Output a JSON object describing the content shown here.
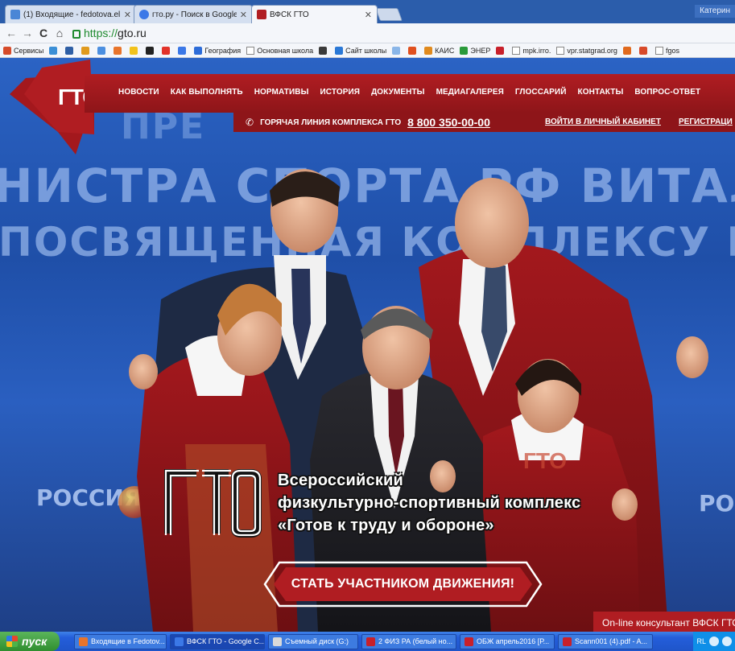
{
  "browser": {
    "tabs": [
      {
        "title": "(1) Входящие - fedotova.el",
        "favicon_color": "#4a86d6",
        "active": false
      },
      {
        "title": "гто.ру - Поиск в Google",
        "favicon_color": "#3b78e7",
        "active": false
      },
      {
        "title": "ВФСК ГТО",
        "favicon_color": "#b01d22",
        "active": true
      }
    ],
    "user_label": "Катерин",
    "url_protocol": "https://",
    "url_host": "gto.ru",
    "bookmarks": [
      {
        "label": "Сервисы",
        "icon": "apps-grid-icon",
        "color": "#d64b2a"
      },
      {
        "label": "",
        "icon": "mail-icon",
        "color": "#3b8fd6"
      },
      {
        "label": "",
        "icon": "vk-icon",
        "color": "#2f5fa5"
      },
      {
        "label": "",
        "icon": "flower-icon",
        "color": "#e09a1e"
      },
      {
        "label": "",
        "icon": "calendar-icon",
        "color": "#4c8fe0"
      },
      {
        "label": "",
        "icon": "play-icon",
        "color": "#e8742b"
      },
      {
        "label": "",
        "icon": "bar-icon",
        "color": "#f2c21b"
      },
      {
        "label": "",
        "icon": "home-icon",
        "color": "#222222"
      },
      {
        "label": "",
        "icon": "yandex-icon",
        "color": "#e2322a"
      },
      {
        "label": "",
        "icon": "google-icon",
        "color": "#3b78e7"
      },
      {
        "label": "География",
        "icon": "globe-icon",
        "color": "#2d6cd8"
      },
      {
        "label": "Основная школа",
        "icon": "doc-icon",
        "color": "#ffffff"
      },
      {
        "label": "",
        "icon": "circle-icon",
        "color": "#3a3a3a"
      },
      {
        "label": "Сайт школы",
        "icon": "flame-icon",
        "color": "#2a78d6"
      },
      {
        "label": "",
        "icon": "page-icon",
        "color": "#8ab6e8"
      },
      {
        "label": "",
        "icon": "plus-icon",
        "color": "#e0501e"
      },
      {
        "label": "КАИС",
        "icon": "kais-icon",
        "color": "#e08a1e"
      },
      {
        "label": "ЭНЕР",
        "icon": "runner-icon",
        "color": "#2a9a3a"
      },
      {
        "label": "",
        "icon": "ng-icon",
        "color": "#c8202a"
      },
      {
        "label": "mpk.irro.",
        "icon": "doc-icon",
        "color": "#ffffff"
      },
      {
        "label": "vpr.statgrad.org",
        "icon": "doc-icon",
        "color": "#ffffff"
      },
      {
        "label": "",
        "icon": "brush-icon",
        "color": "#e06a1e"
      },
      {
        "label": "",
        "icon": "arrow-icon",
        "color": "#d84a2a"
      },
      {
        "label": "fgos",
        "icon": "doc-icon",
        "color": "#ffffff"
      }
    ]
  },
  "site": {
    "logo_text": "ГТО",
    "menu": [
      "НОВОСТИ",
      "КАК ВЫПОЛНЯТЬ",
      "НОРМАТИВЫ",
      "ИСТОРИЯ",
      "ДОКУМЕНТЫ",
      "МЕДИАГАЛЕРЕЯ",
      "ГЛОССАРИЙ",
      "КОНТАКТЫ",
      "ВОПРОС-ОТВЕТ"
    ],
    "hotline_label": "ГОРЯЧАЯ ЛИНИЯ КОМПЛЕКСА ГТО",
    "hotline_number": "8 800 350-00-00",
    "cabinet_link": "ВОЙТИ В ЛИЧНЫЙ КАБИНЕТ",
    "register_link": "РЕГИСТРАЦИ",
    "backdrop_text": {
      "line0": "ПРЕ",
      "line1": "НИСТРА СПОРТА РФ ВИТАЛИЯ МУ",
      "line2": "ПОСВЯЩЕННАЯ КОМПЛЕКСУ ГТО",
      "rossiya": "РОССИЯ",
      "roc": "РОС"
    },
    "brand_lines": [
      "Всероссийский",
      "физкультурно-спортивный комплекс",
      "«Готов к труду и обороне»"
    ],
    "cta_label": "СТАТЬ УЧАСТНИКОМ ДВИЖЕНИЯ!",
    "consultant_label": "On-line консультант ВФСК ГТО",
    "accent_color": "#b01d22"
  },
  "taskbar": {
    "start_label": "пуск",
    "tasks": [
      {
        "label": "Входящие в Fedotov...",
        "color": "#e8742b",
        "active": false
      },
      {
        "label": "ВФСК ГТО - Google C...",
        "color": "#3b78e7",
        "active": true
      },
      {
        "label": "Съемный диск (G:)",
        "color": "#d9d9d9",
        "active": false
      },
      {
        "label": "2 ФИЗ РА (белый но...",
        "color": "#c8202a",
        "active": false
      },
      {
        "label": "ОБЖ апрель2016 [Р...",
        "color": "#c8202a",
        "active": false
      },
      {
        "label": "Scann001 (4).pdf - A...",
        "color": "#c8202a",
        "active": false
      }
    ],
    "tray_lang": "RL"
  }
}
